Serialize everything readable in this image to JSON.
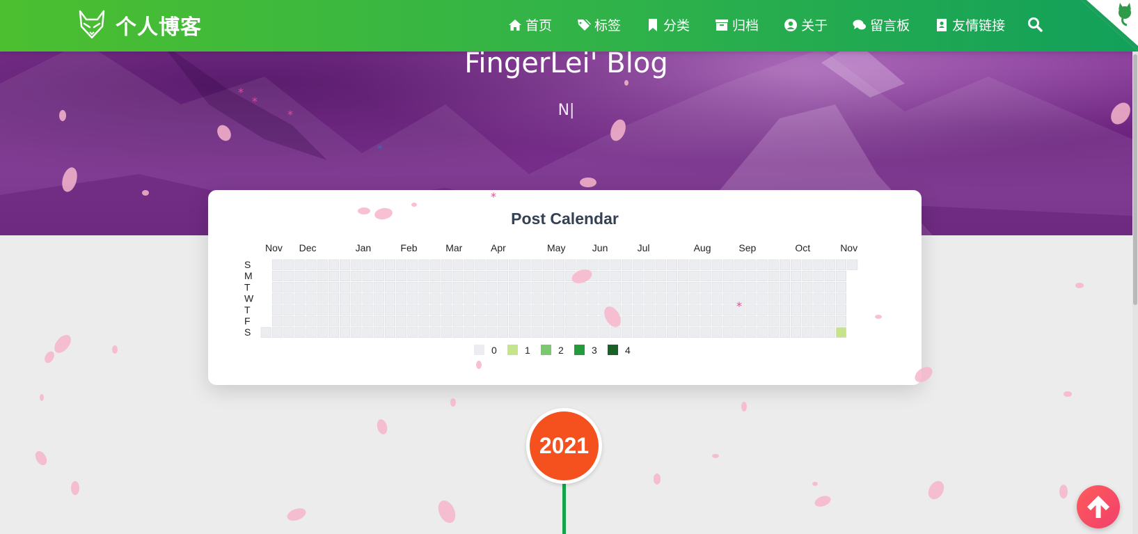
{
  "header": {
    "brand": "个人博客",
    "nav": [
      {
        "label": "首页",
        "icon": "home-icon"
      },
      {
        "label": "标签",
        "icon": "tags-icon"
      },
      {
        "label": "分类",
        "icon": "bookmark-icon"
      },
      {
        "label": "归档",
        "icon": "archive-icon"
      },
      {
        "label": "关于",
        "icon": "user-circle-icon"
      },
      {
        "label": "留言板",
        "icon": "comments-icon"
      },
      {
        "label": "友情链接",
        "icon": "address-card-icon"
      }
    ],
    "search_icon": "search-icon"
  },
  "hero": {
    "title": "FingerLei' Blog",
    "subtitle": "N|"
  },
  "calendar": {
    "title": "Post Calendar",
    "months": [
      "Nov",
      "Dec",
      "Jan",
      "Feb",
      "Mar",
      "Apr",
      "May",
      "Jun",
      "Jul",
      "Aug",
      "Sep",
      "Oct",
      "Nov"
    ],
    "month_week_index": [
      0,
      3,
      8,
      12,
      16,
      20,
      25,
      29,
      33,
      38,
      42,
      47,
      51
    ],
    "weekdays": [
      "S",
      "M",
      "T",
      "W",
      "T",
      "F",
      "S"
    ],
    "weeks": 53,
    "first_week_start_day": 6,
    "last_week_end_day": 0,
    "posts": [
      {
        "week": 51,
        "day": 6,
        "count": 1
      }
    ],
    "legend": [
      {
        "label": "0",
        "color": "#ebedf0"
      },
      {
        "label": "1",
        "color": "#c6e48b"
      },
      {
        "label": "2",
        "color": "#7bc96f"
      },
      {
        "label": "3",
        "color": "#239a3b"
      },
      {
        "label": "4",
        "color": "#196127"
      }
    ]
  },
  "timeline": {
    "year": "2021"
  }
}
